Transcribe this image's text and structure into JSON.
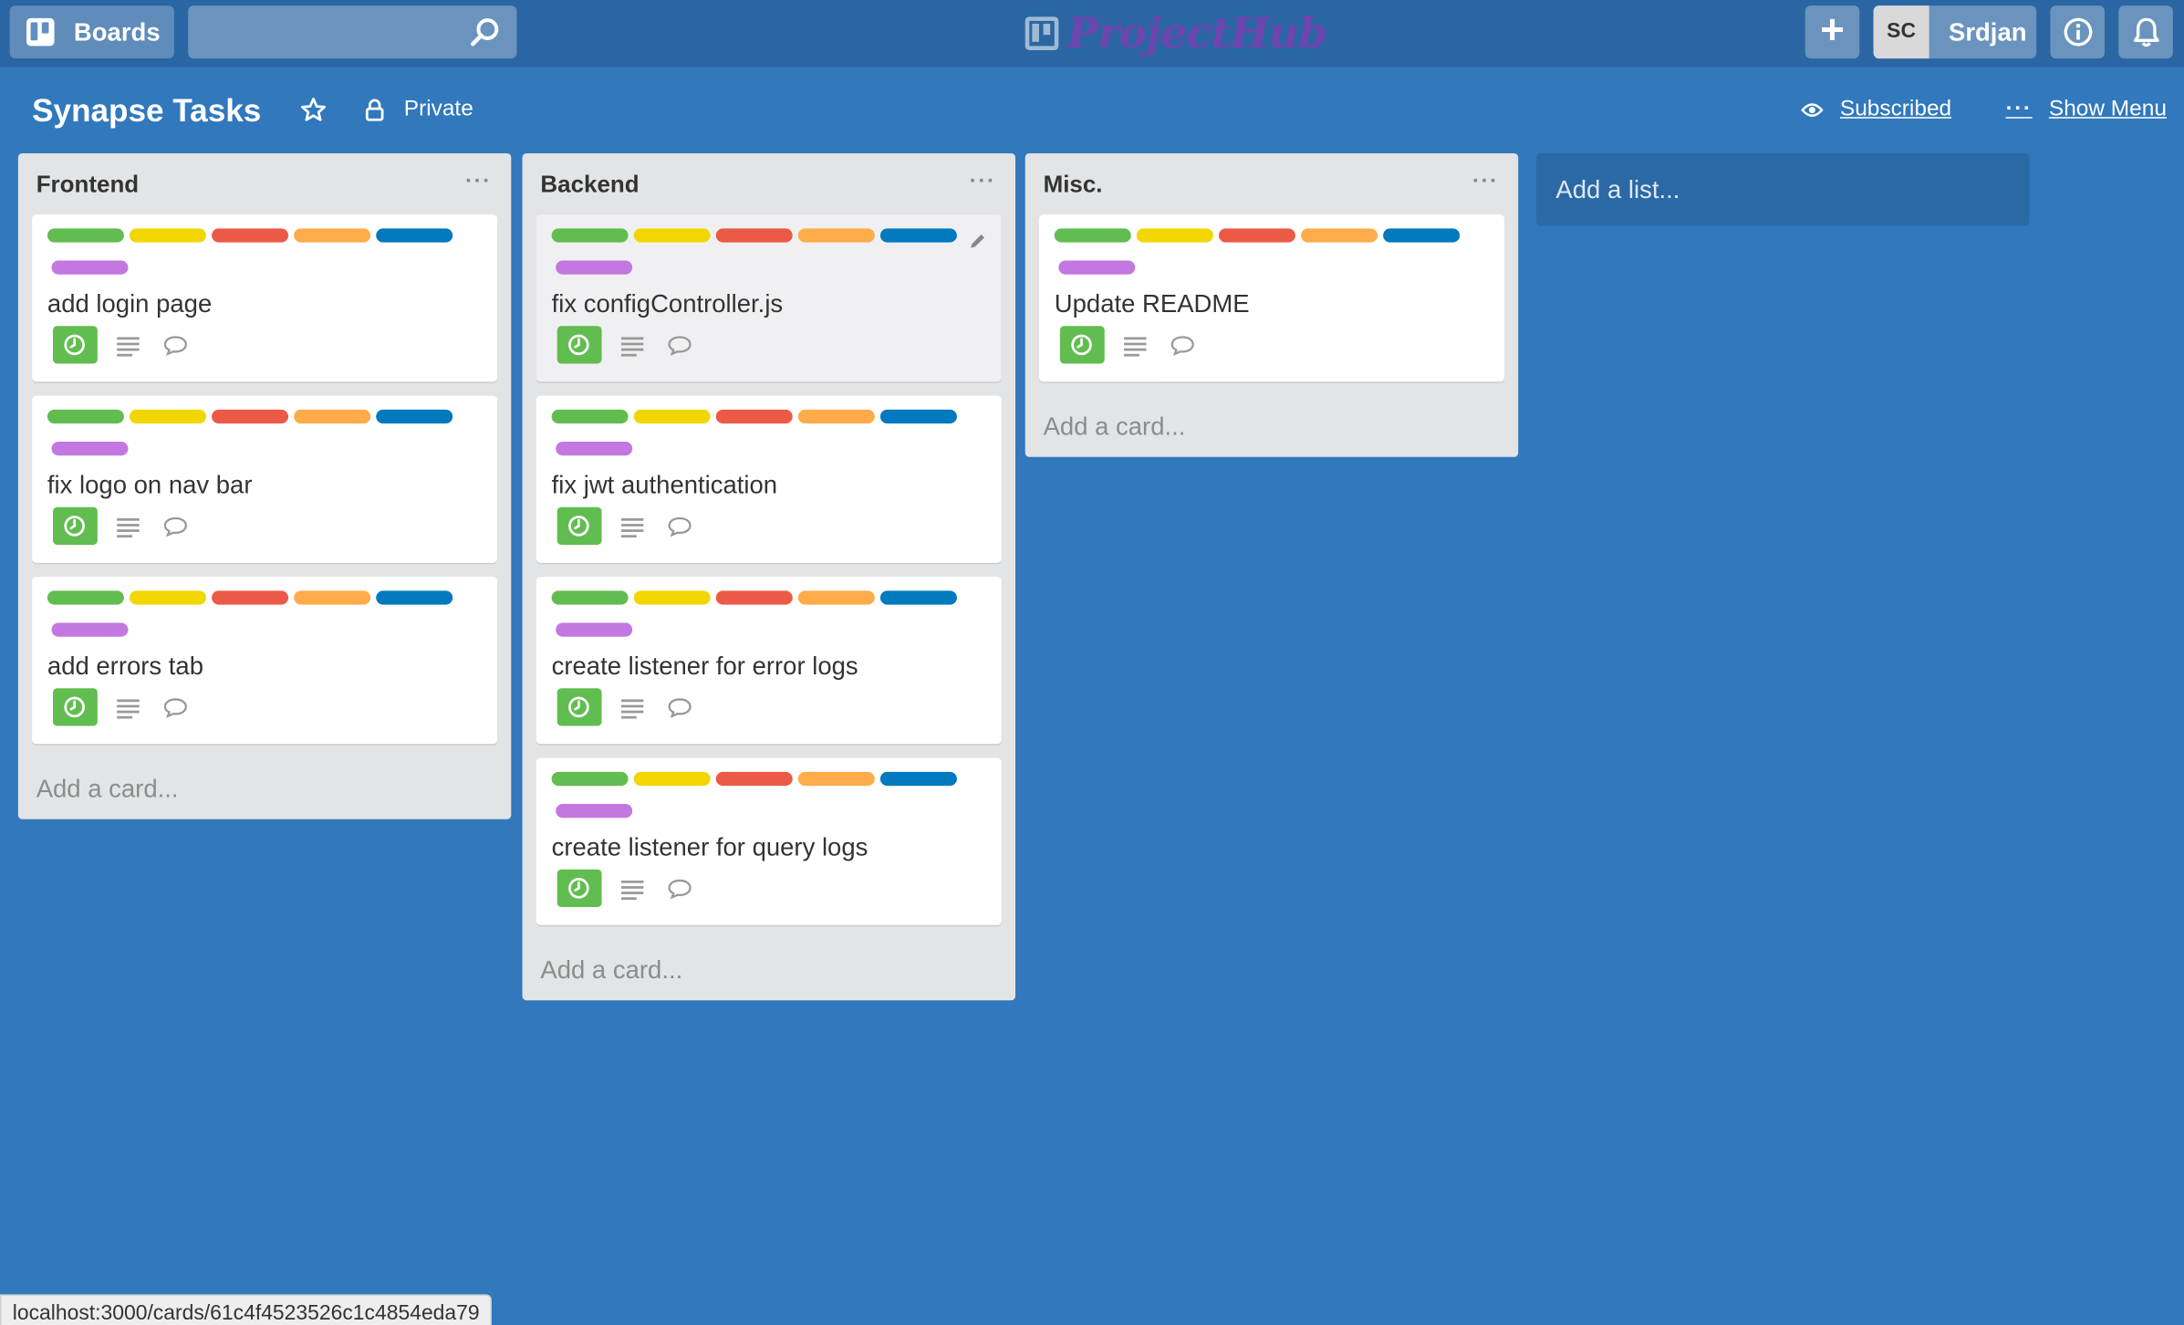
{
  "header": {
    "boards_label": "Boards",
    "search_placeholder": "",
    "logo_text": "ProjectHub",
    "user_initials": "SC",
    "username": "Srdjan"
  },
  "board": {
    "title": "Synapse Tasks",
    "visibility": "Private",
    "subscribed_label": "Subscribed",
    "show_menu_label": "Show Menu"
  },
  "label_colors": [
    "#61bd4f",
    "#f2d600",
    "#eb5a46",
    "#ffab4a",
    "#0079bf",
    "#c377e0"
  ],
  "lists": [
    {
      "title": "Frontend",
      "cards": [
        {
          "title": "add login page"
        },
        {
          "title": "fix logo on nav bar"
        },
        {
          "title": "add errors tab"
        }
      ],
      "add_card_label": "Add a card..."
    },
    {
      "title": "Backend",
      "cards": [
        {
          "title": "fix configController.js"
        },
        {
          "title": "fix jwt authentication"
        },
        {
          "title": "create listener for error logs"
        },
        {
          "title": "create listener for query logs"
        }
      ],
      "add_card_label": "Add a card..."
    },
    {
      "title": "Misc.",
      "cards": [
        {
          "title": "Update README"
        }
      ],
      "add_card_label": "Add a card..."
    }
  ],
  "add_list_label": "Add a list...",
  "status_url": "localhost:3000/cards/61c4f4523526c1c4854eda79"
}
